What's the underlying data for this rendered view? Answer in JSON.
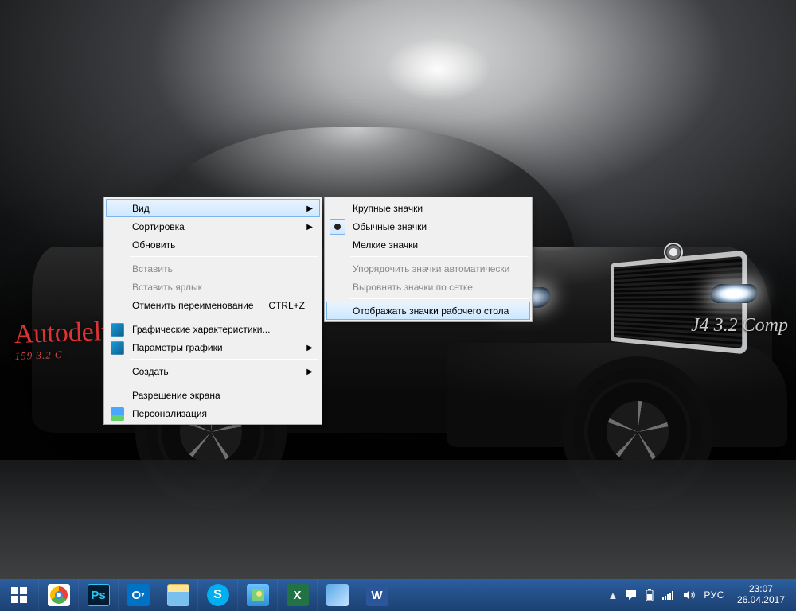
{
  "wallpaper": {
    "side_text": "Autodelt",
    "side_sub": "159 3.2 C",
    "right_badge": "J4 3.2 Comp"
  },
  "context_menu": {
    "view": "Вид",
    "sort": "Сортировка",
    "refresh": "Обновить",
    "paste": "Вставить",
    "paste_shortcut": "Вставить ярлык",
    "undo_rename": "Отменить переименование",
    "undo_shortcut": "CTRL+Z",
    "gfx_props": "Графические характеристики...",
    "gfx_params": "Параметры графики",
    "create": "Создать",
    "screen_res": "Разрешение экрана",
    "personalize": "Персонализация"
  },
  "submenu": {
    "large": "Крупные значки",
    "medium": "Обычные значки",
    "small": "Мелкие значки",
    "auto_arrange": "Упорядочить значки автоматически",
    "align_grid": "Выровнять значки по сетке",
    "show_desktop_icons": "Отображать значки рабочего стола"
  },
  "taskbar": {
    "apps": {
      "chrome": "Google Chrome",
      "ps": "Ps",
      "outlook_abbrev": "O",
      "outlook_abbrev2": "z",
      "excel_abbrev": "X",
      "word_abbrev": "W"
    },
    "tray": {
      "lang": "РУС",
      "time": "23:07",
      "date": "26.04.2017"
    }
  }
}
